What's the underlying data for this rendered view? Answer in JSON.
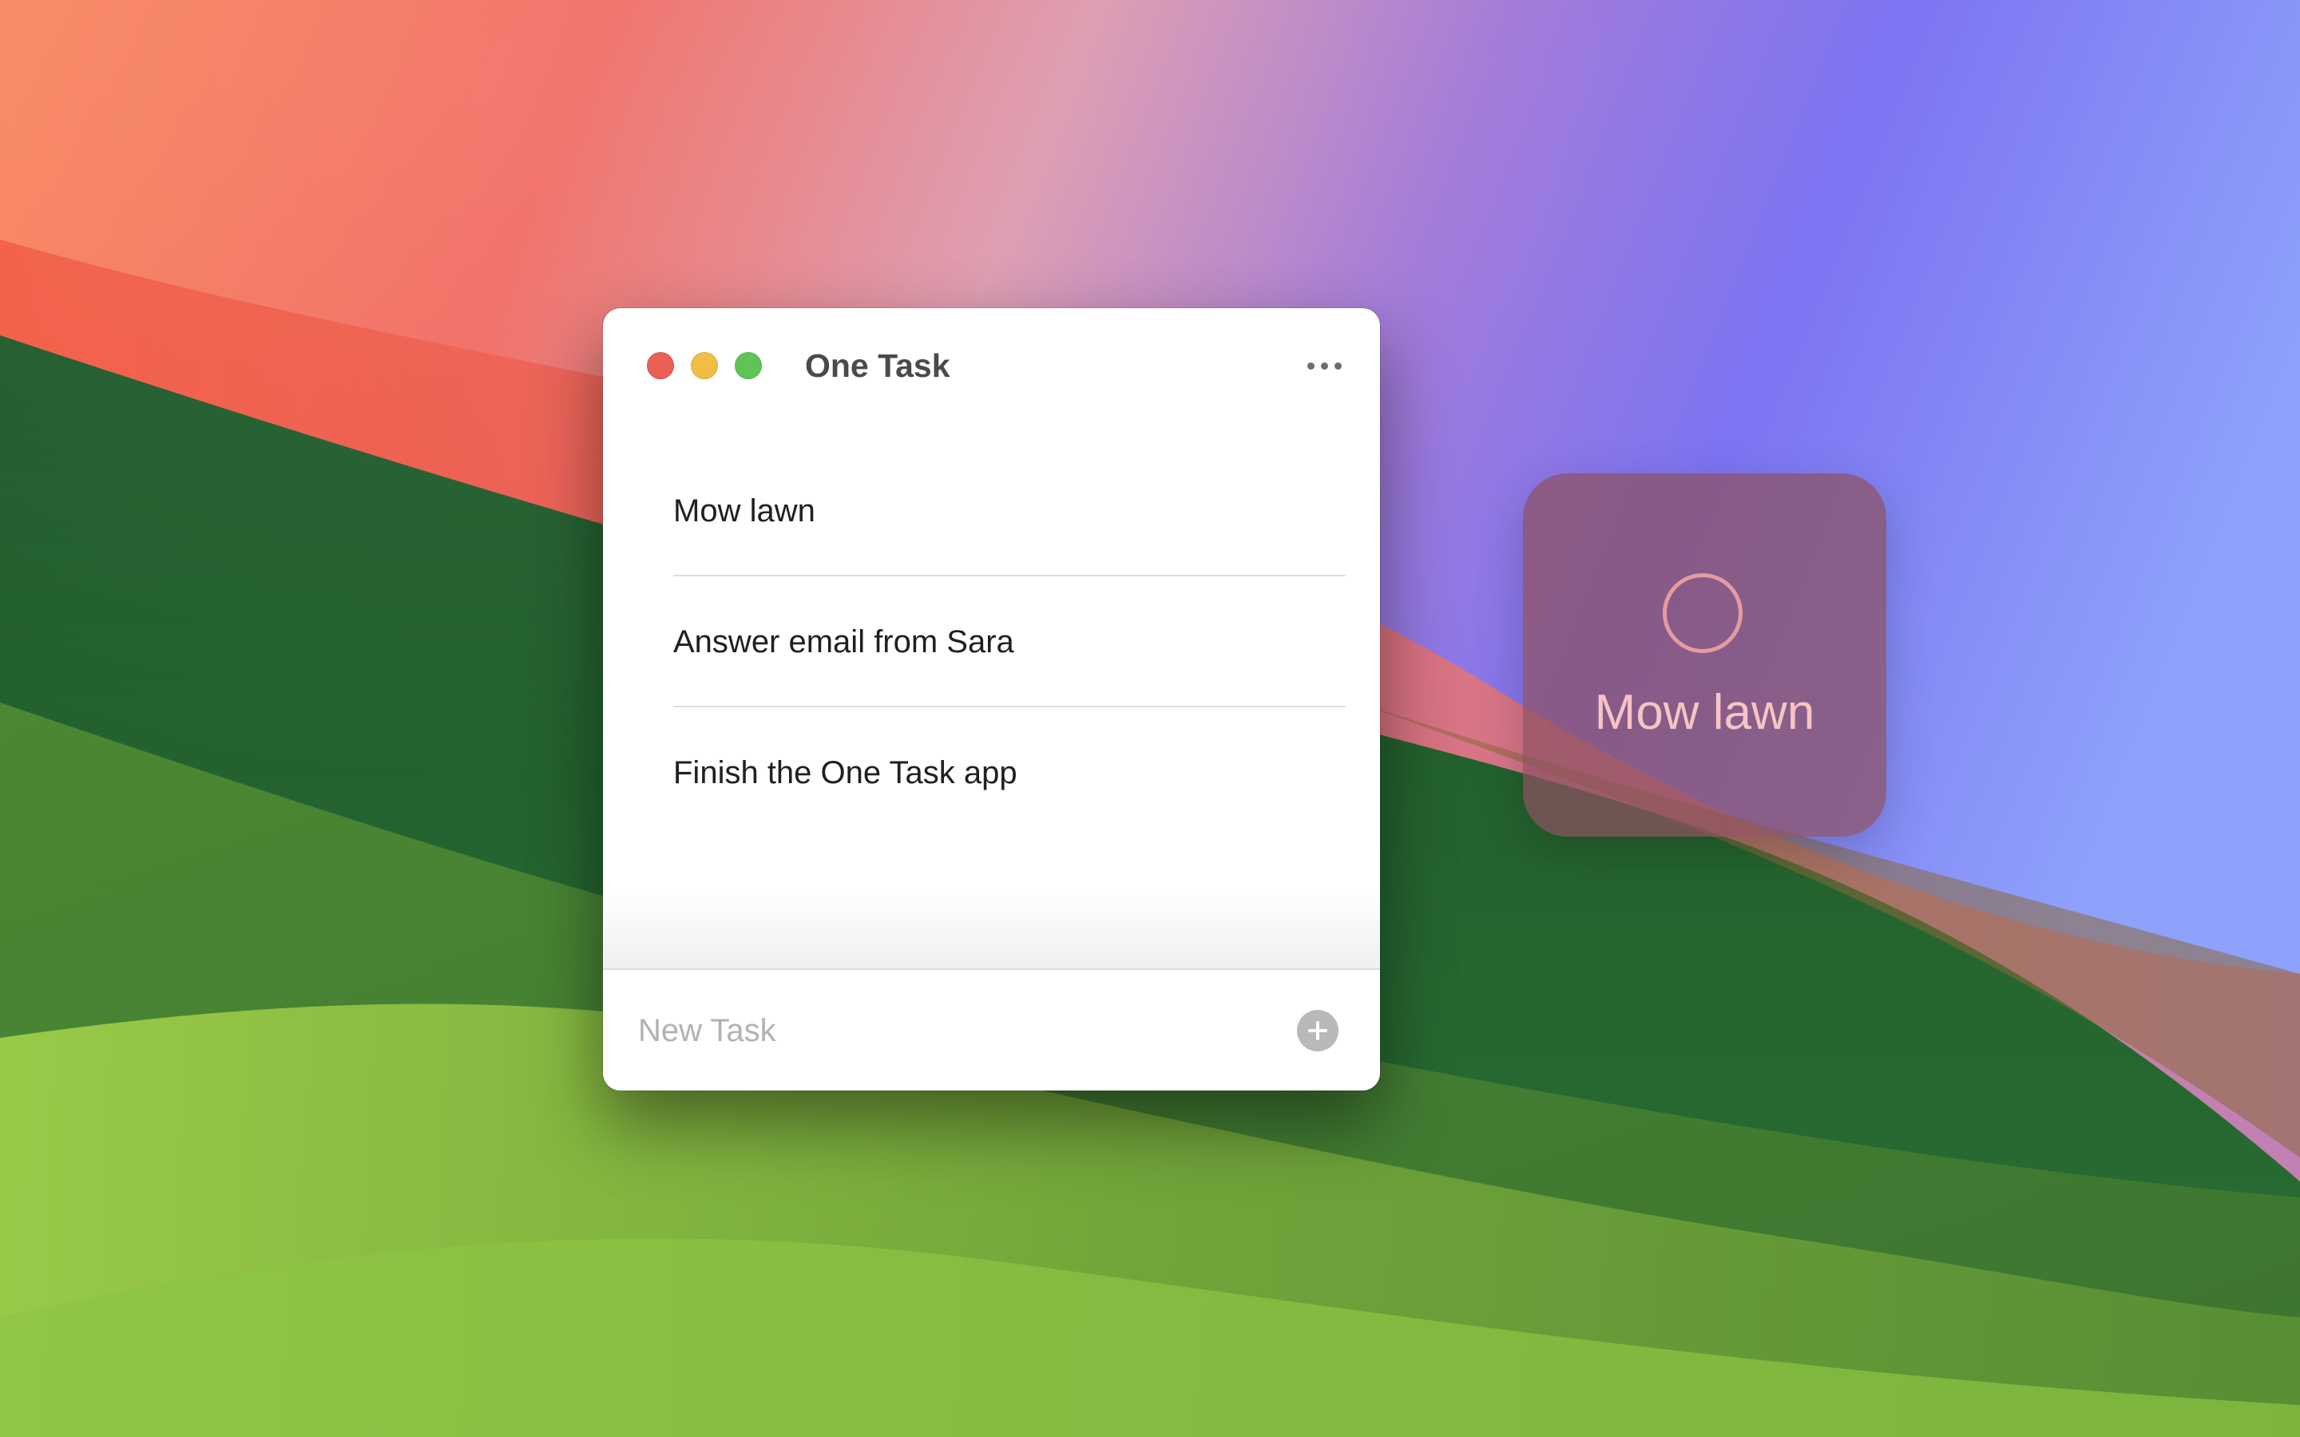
{
  "window": {
    "title": "One Task",
    "more_icon": "ellipsis-icon"
  },
  "tasks": [
    {
      "label": "Mow lawn"
    },
    {
      "label": "Answer email from Sara"
    },
    {
      "label": "Finish the One Task app"
    }
  ],
  "footer": {
    "placeholder": "New Task",
    "add_icon": "plus-circle-icon"
  },
  "widget": {
    "task_label": "Mow lawn",
    "checkbox_icon": "circle-icon",
    "label_color": "#f6c4c4",
    "ring_color": "#e79aa2"
  },
  "colors": {
    "close": "#ec5f57",
    "minimize": "#f1bd45",
    "maximize": "#5fc453"
  }
}
